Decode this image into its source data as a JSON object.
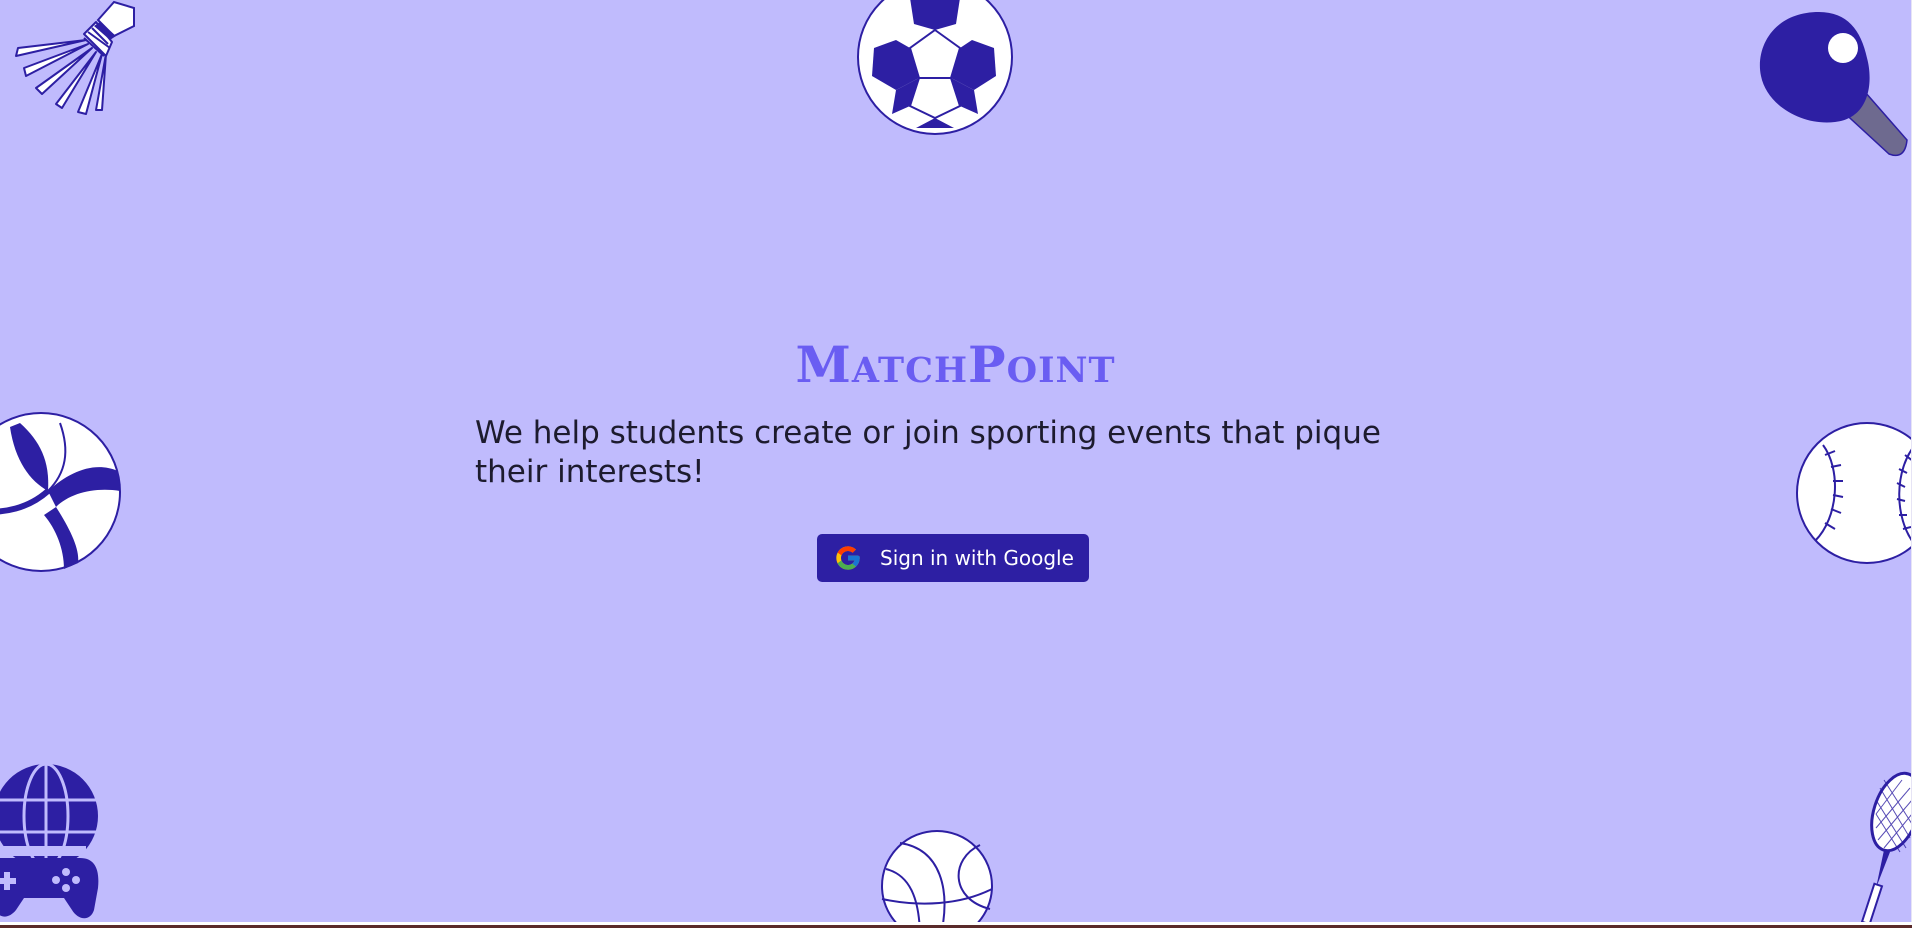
{
  "brand": {
    "title": "MatchPoint"
  },
  "hero": {
    "tagline": "We help students create or join sporting events that pique their interests!"
  },
  "auth": {
    "google_signin_label": "Sign in with Google",
    "google_icon": "google-g-logo"
  },
  "decorations": [
    {
      "name": "shuttlecock-icon"
    },
    {
      "name": "soccer-ball-icon"
    },
    {
      "name": "ping-pong-paddle-icon"
    },
    {
      "name": "volleyball-icon"
    },
    {
      "name": "baseball-icon"
    },
    {
      "name": "gaming-globe-controller-icon"
    },
    {
      "name": "basketball-icon"
    },
    {
      "name": "tennis-racket-icon"
    }
  ],
  "colors": {
    "background": "#c0bbfd",
    "brand": "#6a5df2",
    "accent": "#2d1fa3",
    "text": "#1d1b2e"
  }
}
